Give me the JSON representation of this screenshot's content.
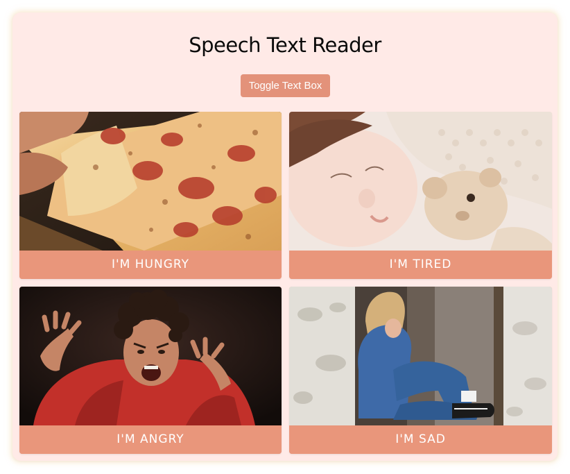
{
  "app": {
    "title": "Speech Text Reader",
    "toggle_button_label": "Toggle Text Box"
  },
  "tiles": [
    {
      "caption": "I'M HUNGRY",
      "image": "pizza-slice-image"
    },
    {
      "caption": "I'M TIRED",
      "image": "sleeping-child-image"
    },
    {
      "caption": "I'M ANGRY",
      "image": "angry-child-image"
    },
    {
      "caption": "I'M SAD",
      "image": "sad-child-image"
    }
  ],
  "colors": {
    "card_background": "#ffeae7",
    "accent": "#e9967b",
    "button": "#e3927a",
    "caption_text": "#ffffff"
  }
}
